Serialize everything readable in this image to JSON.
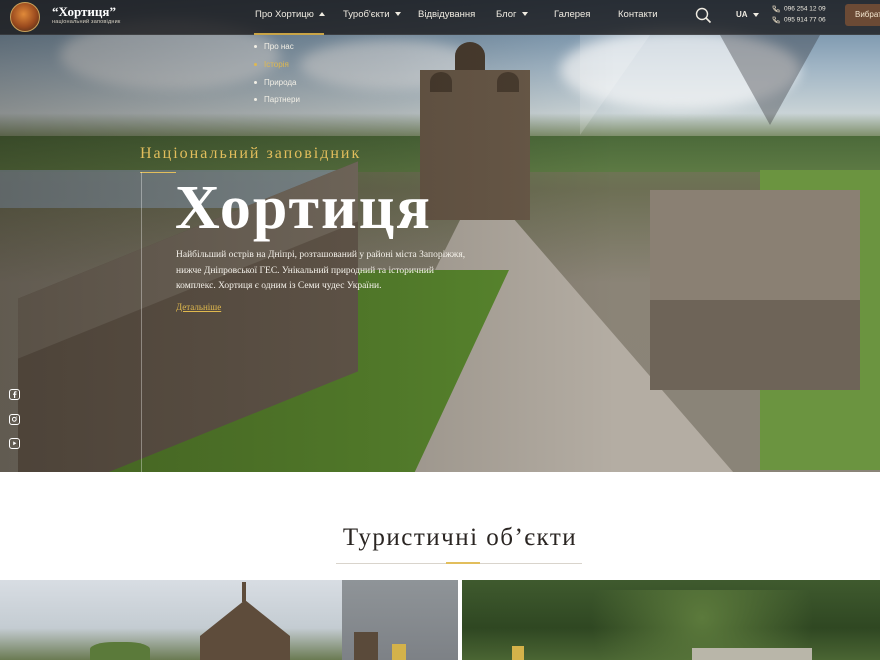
{
  "logo": {
    "title": "“Хортиця”",
    "subtitle": "національний заповідник"
  },
  "nav": {
    "items": [
      {
        "label": "Про Хортицю",
        "dropdown": true,
        "open": true
      },
      {
        "label": "Туроб'єкти",
        "dropdown": true,
        "open": false
      },
      {
        "label": "Відвідування",
        "dropdown": false
      },
      {
        "label": "Блог",
        "dropdown": true,
        "open": false
      },
      {
        "label": "Галерея",
        "dropdown": false
      },
      {
        "label": "Контакти",
        "dropdown": false
      }
    ],
    "language": "UA",
    "phones": [
      "096 254 12 09",
      "095 914 77 06"
    ],
    "cta_label": "Вибрати"
  },
  "dropdown": {
    "items": [
      "Про нас",
      "Історія",
      "Природа",
      "Партнери"
    ],
    "active_index": 1
  },
  "hero": {
    "subtitle": "Національний заповідник",
    "title": "Хортиця",
    "description": "Найбільший острів на Дніпрі, розташований у районі міста Запоріжжя, нижче Дніпровської ГЕС. Унікальний природний та історичний комплекс. Хортиця є одним із Семи чудес України.",
    "more_link": "Детальніше"
  },
  "social": [
    "facebook-icon",
    "instagram-icon",
    "youtube-icon"
  ],
  "section": {
    "title": "Туристичні об’єкти"
  },
  "colors": {
    "accent_gold": "#e2be5c",
    "nav_bg": "#1c1c1e",
    "cta_bg": "#6b4a35"
  }
}
